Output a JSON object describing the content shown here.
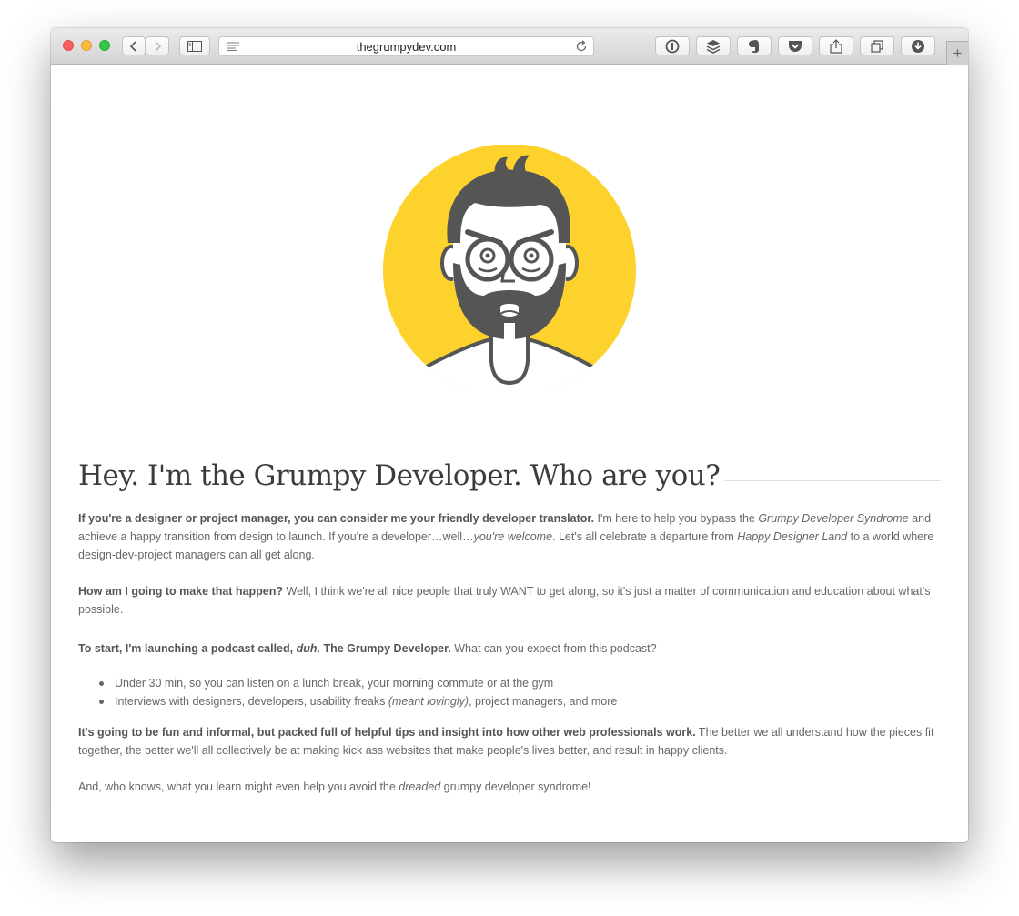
{
  "browser": {
    "url": "thegrumpydev.com",
    "tab_new_label": "+"
  },
  "colors": {
    "accent_yellow": "#fdd22d",
    "character_gray": "#555555",
    "text": "#666666",
    "heading": "#3b3b3b"
  },
  "icons": {
    "back": "chevron-left-icon",
    "forward": "chevron-right-icon",
    "sidebar": "sidebar-icon",
    "reader": "reader-icon",
    "reload": "reload-icon",
    "extensions": [
      "1password-icon",
      "buffer-icon",
      "evernote-icon",
      "pocket-icon",
      "share-icon",
      "tabs-icon",
      "download-icon"
    ]
  },
  "page": {
    "heading": "Hey. I'm the Grumpy Developer. Who are you?",
    "p1": {
      "bold": "If you're a designer or project manager, you can consider me your friendly developer translator.",
      "t1": " I'm here to help you bypass the ",
      "i1": "Grumpy Developer Syndrome",
      "t2": " and achieve a happy transition from design to launch. If you're a developer…well…",
      "i2": "you're welcome",
      "t3": ". Let's all celebrate a departure from ",
      "i3": "Happy Designer Land",
      "t4": " to a world where design-dev-project managers can all get along."
    },
    "p2": {
      "bold": "How am I going to make that happen?",
      "t1": " Well, I think we're all nice people that truly WANT to get along, so it's just a matter of communication and education about what's possible."
    },
    "p3": {
      "bold1": "To start, I'm launching a podcast called, ",
      "bold_i": "duh,",
      "bold2": " The Grumpy Developer.",
      "t1": " What can you expect from this podcast?"
    },
    "bullets": [
      {
        "t1": "Under 30 min, so you can listen on a lunch break, your morning commute or at the gym",
        "i1": "",
        "t2": ""
      },
      {
        "t1": "Interviews with designers, developers, usability freaks ",
        "i1": "(meant lovingly)",
        "t2": ", project managers, and more"
      }
    ],
    "p4": {
      "bold": "It's going to be fun and informal, but packed full of helpful tips and insight into how other web professionals work.",
      "t1": " The better we all understand how the pieces fit together, the better we'll all collectively be at making kick ass websites that make people's lives better, and result in happy clients."
    },
    "p5": {
      "t1": "And, who knows, what you learn might even help you avoid the ",
      "i1": "dreaded",
      "t2": " grumpy developer syndrome!"
    }
  }
}
